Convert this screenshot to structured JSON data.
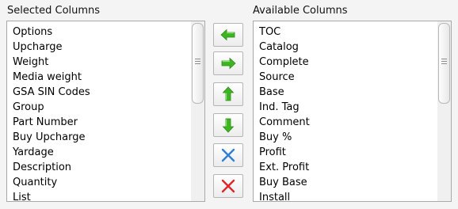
{
  "selected": {
    "title": "Selected Columns",
    "items": [
      "Options",
      "Upcharge",
      "Weight",
      "Media weight",
      "GSA SIN Codes",
      "Group",
      "Part Number",
      "Buy Upcharge",
      "Yardage",
      "Description",
      "Quantity",
      "List"
    ]
  },
  "available": {
    "title": "Available Columns",
    "items": [
      "TOC",
      "Catalog",
      "Complete",
      "Source",
      "Base",
      "Ind. Tag",
      "Comment",
      "Buy %",
      "Profit",
      "Ext. Profit",
      "Buy Base",
      "Install"
    ]
  },
  "buttons": [
    {
      "name": "move-left-button",
      "icon": "arrow-left-icon",
      "color": "#3cb521"
    },
    {
      "name": "move-right-button",
      "icon": "arrow-right-icon",
      "color": "#3cb521"
    },
    {
      "name": "move-up-button",
      "icon": "arrow-up-icon",
      "color": "#3cb521"
    },
    {
      "name": "move-down-button",
      "icon": "arrow-down-icon",
      "color": "#3cb521"
    },
    {
      "name": "remove-button",
      "icon": "x-blue-icon",
      "color": "#2d7fd6"
    },
    {
      "name": "clear-button",
      "icon": "x-red-icon",
      "color": "#e0252b"
    }
  ]
}
